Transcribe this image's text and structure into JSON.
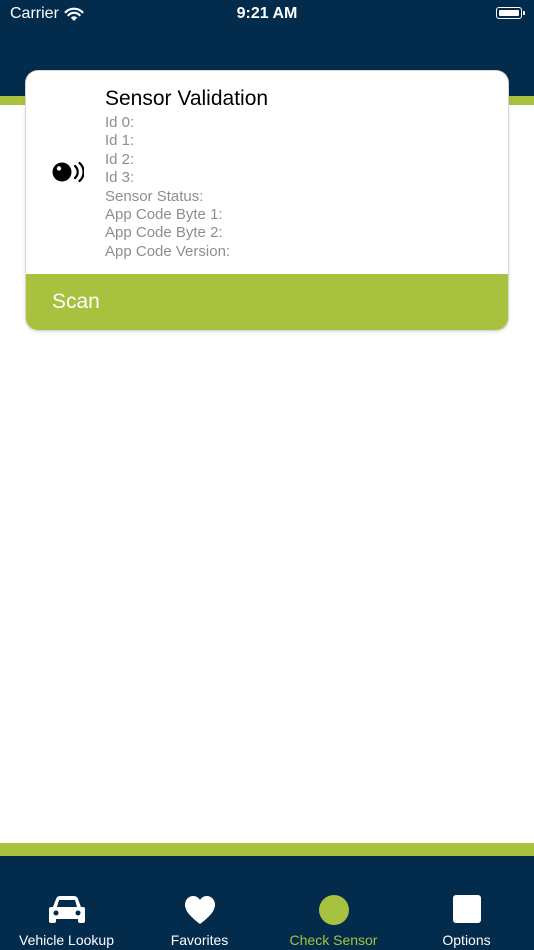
{
  "status_bar": {
    "carrier": "Carrier",
    "time": "9:21 AM"
  },
  "card": {
    "title": "Sensor Validation",
    "icon": "sensor-signal-icon",
    "fields": [
      "Id 0:",
      "Id 1:",
      "Id 2:",
      "Id 3:",
      "Sensor Status:",
      "App Code Byte 1:",
      "App Code Byte 2:",
      "App Code Version:"
    ],
    "scan_label": "Scan"
  },
  "tabs": [
    {
      "label": "Vehicle Lookup",
      "icon": "car-icon",
      "active": false
    },
    {
      "label": "Favorites",
      "icon": "heart-icon",
      "active": false
    },
    {
      "label": "Check Sensor",
      "icon": "circle-icon",
      "active": true
    },
    {
      "label": "Options",
      "icon": "square-icon",
      "active": false
    }
  ],
  "colors": {
    "navy": "#022b4c",
    "accent_green": "#a8c23f",
    "field_gray": "#8e8e8e"
  }
}
